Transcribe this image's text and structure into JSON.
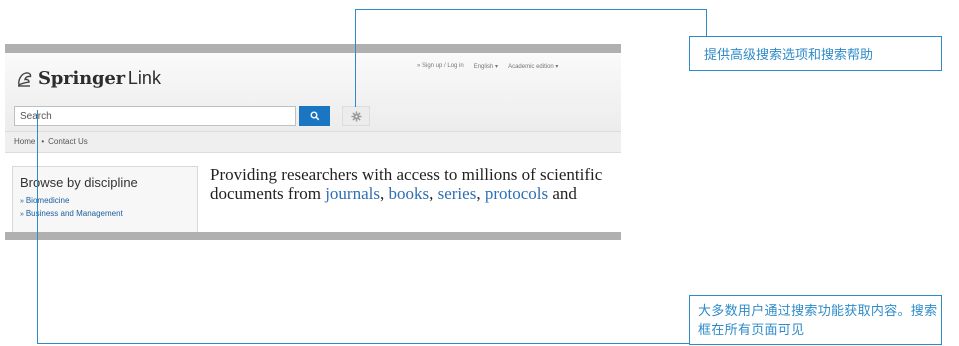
{
  "header": {
    "logo_springer": "Springer",
    "logo_link": "Link",
    "top_links": [
      "» Sign up / Log in",
      "English ▾",
      "Academic edition ▾"
    ]
  },
  "search": {
    "placeholder": "Search"
  },
  "breadcrumb": {
    "home": "Home",
    "separator": "•",
    "contact": "Contact Us"
  },
  "browse": {
    "title": "Browse by discipline",
    "links": [
      "Biomedicine",
      "Business and Management"
    ]
  },
  "tagline": {
    "text_1": "Providing researchers with access to millions of scientific documents from",
    "link_journals": "journals",
    "link_books": "books",
    "link_series": "series",
    "link_protocols": "protocols",
    "comma": ",",
    "text_and": "and"
  },
  "callouts": {
    "advanced_search": "提供高级搜索选项和搜索帮助",
    "search_box": "大多数用户通过搜索功能获取内容。搜索框在所有页面可见"
  },
  "colors": {
    "accent": "#2e8bc9",
    "search_button": "#1a76c2",
    "link": "#2f6fb3"
  }
}
